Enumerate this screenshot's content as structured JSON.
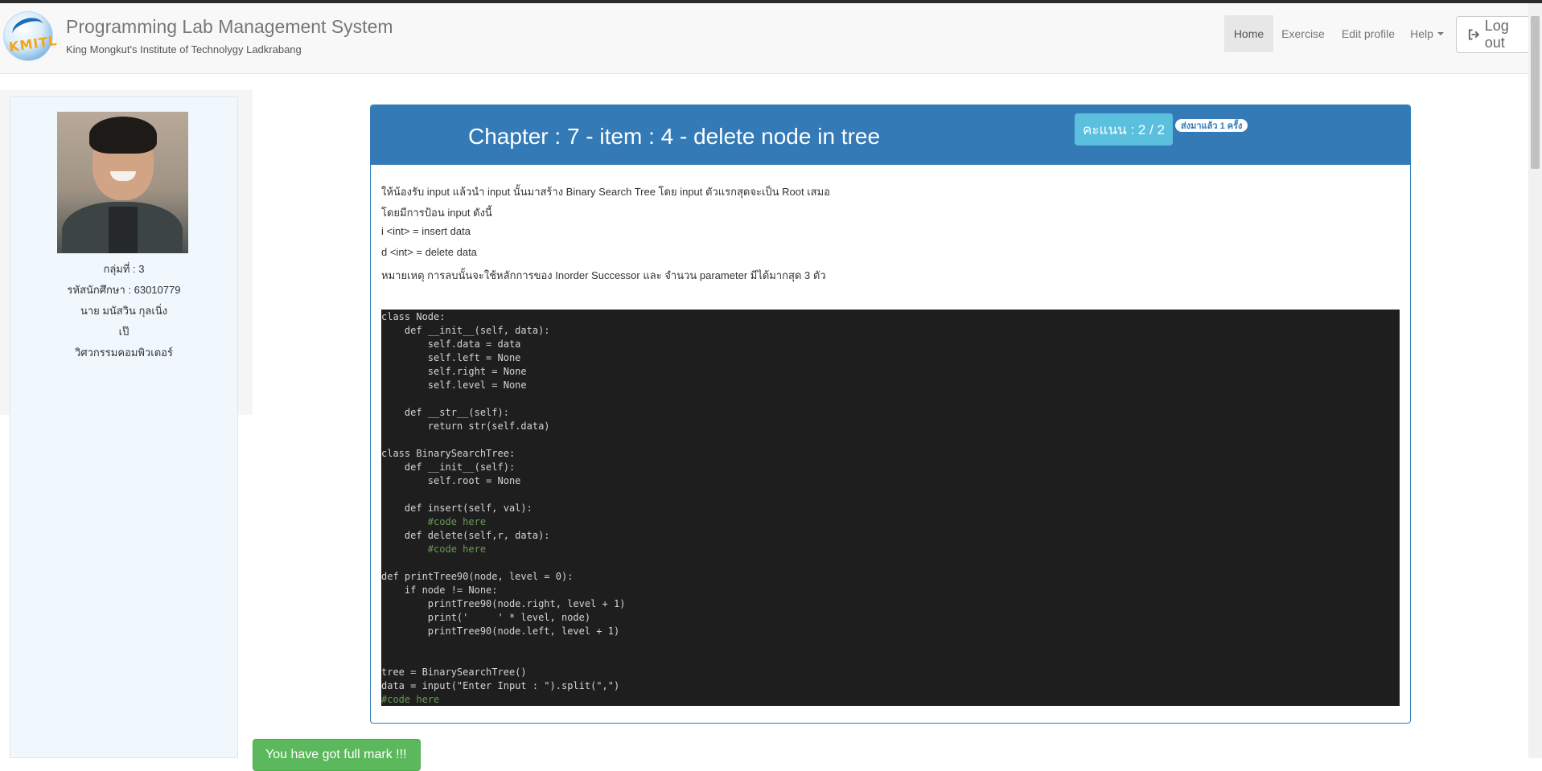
{
  "header": {
    "title": "Programming Lab Management System",
    "subtitle": "King Mongkut's Institute of Technolygy Ladkrabang",
    "logo_text": "KMITL"
  },
  "nav": {
    "home": "Home",
    "exercise": "Exercise",
    "edit_profile": "Edit profile",
    "help": "Help",
    "logout": "Log out"
  },
  "student": {
    "group": "กลุ่มที่ : 3",
    "student_id": "รหัสนักศึกษา : 63010779",
    "name": "นาย มนัสวิน กุลเนิ่ง",
    "nickname": "เป๊",
    "department": "วิศวกรรมคอมพิวเตอร์"
  },
  "exercise": {
    "title": "Chapter : 7 - item : 4 - delete node in tree",
    "score": "คะแนน : 2 / 2",
    "submitted": "ส่งมาแล้ว 1 ครั้ง",
    "description": [
      "ให้น้องรับ input แล้วนำ input นั้นมาสร้าง Binary Search Tree โดย input ตัวแรกสุดจะเป็น Root เสมอ",
      "โดยมีการป้อน input ดังนี้",
      "i <int> = insert data",
      "d <int> = delete data",
      "หมายเหตุ การลบนั้นจะใช้หลักการของ Inorder Successor และ จำนวน parameter มีได้มากสุด 3 ตัว"
    ]
  },
  "code": {
    "l1": "class Node:",
    "l2": "    def __init__(self, data):",
    "l3": "        self.data = data",
    "l4": "        self.left = None",
    "l5": "        self.right = None",
    "l6": "        self.level = None",
    "l7": "    def __str__(self):",
    "l8": "        return str(self.data)",
    "l9": "class BinarySearchTree:",
    "l10": "    def __init__(self):",
    "l11": "        self.root = None",
    "l12": "    def insert(self, val):",
    "l13": "        #code here",
    "l14": "    def delete(self,r, data):",
    "l15": "        #code here",
    "l16": "def printTree90(node, level = 0):",
    "l17": "    if node != None:",
    "l18": "        printTree90(node.right, level + 1)",
    "l19": "        print('     ' * level, node)",
    "l20": "        printTree90(node.left, level + 1)",
    "l21": "tree = BinarySearchTree()",
    "l22": "data = input(\"Enter Input : \").split(\",\")",
    "l23": "#code here"
  },
  "result": {
    "full_mark": "You have got full mark !!!"
  }
}
